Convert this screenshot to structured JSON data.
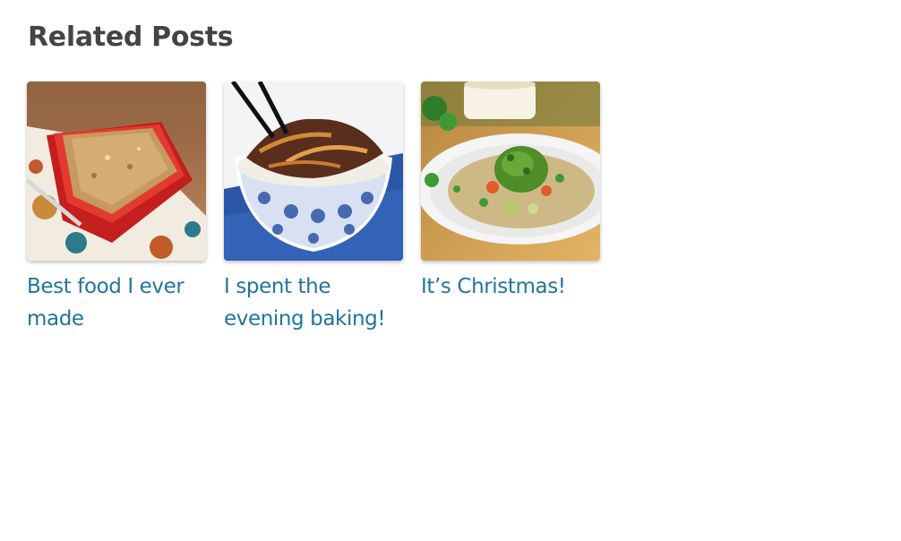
{
  "related": {
    "heading": "Related Posts",
    "posts": [
      {
        "title": "Best food I ever made",
        "image": "baked-crumble-dish-image"
      },
      {
        "title": "I spent the evening baking!",
        "image": "beef-rice-bowl-image"
      },
      {
        "title": "It’s Christmas!",
        "image": "taco-plate-image"
      }
    ]
  },
  "colors": {
    "heading": "#444444",
    "link": "#21759b"
  }
}
